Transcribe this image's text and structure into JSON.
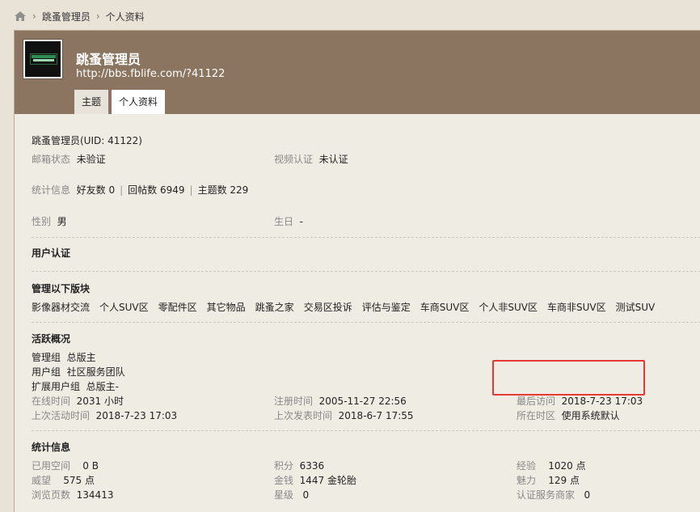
{
  "breadcrumb": {
    "home_icon": "home-icon",
    "items": [
      "跳蚤管理员",
      "个人资料"
    ]
  },
  "profile": {
    "username": "跳蚤管理员",
    "url": "http://bbs.fblife.com/?41122"
  },
  "tabs": [
    "主题",
    "个人资料"
  ],
  "basic": {
    "title": "跳蚤管理员(UID: 41122)",
    "email_label": "邮箱状态",
    "email_value": "未验证",
    "video_label": "视频认证",
    "video_value": "未认证",
    "stats_label": "统计信息",
    "friends": "好友数 0",
    "replies": "回帖数 6949",
    "topics": "主题数 229",
    "gender_label": "性别",
    "gender_value": "男",
    "birthday_label": "生日",
    "birthday_value": "-"
  },
  "verify": {
    "title": "用户认证"
  },
  "boards": {
    "title": "管理以下版块",
    "items": [
      "影像器材交流",
      "个人SUV区",
      "零配件区",
      "其它物品",
      "跳蚤之家",
      "交易区投诉",
      "评估与鉴定",
      "车商SUV区",
      "个人非SUV区",
      "车商非SUV区",
      "测试SUV"
    ]
  },
  "activity": {
    "title": "活跃概况",
    "admin_group_label": "管理组",
    "admin_group_value": "总版主",
    "user_group_label": "用户组",
    "user_group_value": "社区服务团队",
    "ext_group_label": "扩展用户组",
    "ext_group_value": "总版主-",
    "online_label": "在线时间",
    "online_value": "2031 小时",
    "register_label": "注册时间",
    "register_value": "2005-11-27 22:56",
    "last_visit_label": "最后访问",
    "last_visit_value": "2018-7-23 17:03",
    "last_active_label": "上次活动时间",
    "last_active_value": "2018-7-23 17:03",
    "last_post_label": "上次发表时间",
    "last_post_value": "2018-6-7 17:55",
    "timezone_label": "所在时区",
    "timezone_value": "使用系统默认"
  },
  "stats": {
    "title": "统计信息",
    "space_label": "已用空间",
    "space_value": "0 B",
    "points_label": "积分",
    "points_value": "6336",
    "exp_label": "经验",
    "exp_value": "1020 点",
    "prestige_label": "威望",
    "prestige_value": "575 点",
    "money_label": "金钱",
    "money_value": "1447 金轮胎",
    "charm_label": "魅力",
    "charm_value": "129 点",
    "views_label": "浏览页数",
    "views_value": "134413",
    "stars_label": "星级",
    "stars_value": "0",
    "merchant_label": "认证服务商家",
    "merchant_value": "0"
  },
  "colors": {
    "header_bg": "#8b7560",
    "page_bg": "#e9e2d7",
    "panel_bg": "#efece4",
    "highlight": "#e53935"
  }
}
